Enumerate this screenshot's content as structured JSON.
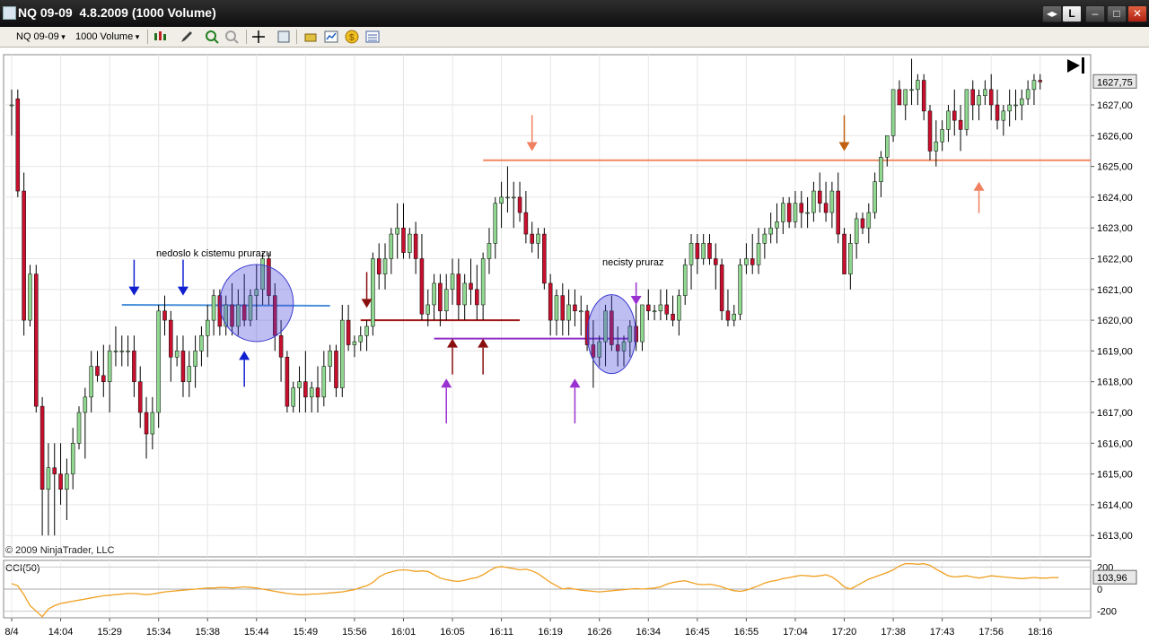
{
  "window": {
    "title": "NQ 09-09  4.8.2009 (1000 Volume)",
    "buttons": [
      "◂▸",
      "L",
      "–",
      "□",
      "✕"
    ]
  },
  "toolbar": {
    "instrument": "NQ 09-09",
    "period": "1000 Volume",
    "icons": [
      "candlestick-chart-icon",
      "pencil-draw-icon",
      "zoom-in-icon",
      "zoom-out-icon",
      "crosshair-icon",
      "data-box-icon",
      "strategy-icon",
      "indicator-icon",
      "money-icon",
      "properties-icon"
    ]
  },
  "colors": {
    "up": "#90d890",
    "down": "#c8102e",
    "wick": "#000000",
    "cci": "#f0a020",
    "blue_line": "#4a90d9",
    "orange_line": "#f08860",
    "darkred_line": "#a01818",
    "purple_line": "#9030c8"
  },
  "chart_data": {
    "type": "candlestick",
    "instrument": "NQ 09-09",
    "copyright": "© 2009 NinjaTrader, LLC",
    "price_axis": [
      "1627,00",
      "1626,00",
      "1625,00",
      "1624,00",
      "1623,00",
      "1622,00",
      "1621,00",
      "1620,00",
      "1619,00",
      "1618,00",
      "1617,00",
      "1616,00",
      "1615,00",
      "1614,00",
      "1613,00"
    ],
    "last_price": "1627,75",
    "ylim": [
      1612.5,
      1628.5
    ],
    "time_axis": [
      "8/4",
      "14:04",
      "15:29",
      "15:34",
      "15:38",
      "15:44",
      "15:49",
      "15:56",
      "16:01",
      "16:05",
      "16:11",
      "16:19",
      "16:26",
      "16:34",
      "16:45",
      "16:55",
      "17:04",
      "17:20",
      "17:38",
      "17:43",
      "17:56",
      "18:16"
    ],
    "time_tick_bars": [
      0,
      8,
      16,
      24,
      32,
      40,
      48,
      56,
      64,
      72,
      80,
      88,
      96,
      104,
      112,
      120,
      128,
      136,
      144,
      152,
      160,
      168
    ],
    "annotations": {
      "cistemu": "nedoslo k cistemu prurazu",
      "necisty": "necisty pruraz"
    },
    "levels": {
      "blue": 1620.5,
      "orange": 1625.2,
      "darkred": 1620.0,
      "purple": 1619.4
    },
    "candles": [
      [
        1627.0,
        1627.5,
        1626.0,
        1627.0
      ],
      [
        1627.2,
        1627.5,
        1624.0,
        1624.2
      ],
      [
        1624.2,
        1624.8,
        1619.5,
        1620.0
      ],
      [
        1620.0,
        1621.8,
        1619.8,
        1621.5
      ],
      [
        1621.5,
        1621.8,
        1617.0,
        1617.2
      ],
      [
        1617.2,
        1617.5,
        1613.0,
        1614.5
      ],
      [
        1614.5,
        1616.0,
        1613.0,
        1615.2
      ],
      [
        1615.2,
        1616.0,
        1613.0,
        1615.0
      ],
      [
        1615.0,
        1616.0,
        1614.0,
        1614.5
      ],
      [
        1614.5,
        1615.5,
        1613.5,
        1615.0
      ],
      [
        1615.0,
        1616.5,
        1614.5,
        1616.0
      ],
      [
        1616.0,
        1617.2,
        1615.8,
        1617.0
      ],
      [
        1617.0,
        1617.8,
        1615.5,
        1617.5
      ],
      [
        1617.5,
        1619.0,
        1617.0,
        1618.5
      ],
      [
        1618.5,
        1619.0,
        1618.0,
        1618.2
      ],
      [
        1618.2,
        1619.2,
        1617.5,
        1618.0
      ],
      [
        1618.0,
        1619.2,
        1617.0,
        1619.0
      ],
      [
        1619.0,
        1619.8,
        1618.5,
        1619.0
      ],
      [
        1619.0,
        1619.5,
        1618.5,
        1619.0
      ],
      [
        1619.0,
        1619.5,
        1618.5,
        1619.0
      ],
      [
        1619.0,
        1619.5,
        1617.5,
        1618.0
      ],
      [
        1618.0,
        1618.5,
        1616.5,
        1617.0
      ],
      [
        1617.0,
        1617.5,
        1615.5,
        1616.3
      ],
      [
        1616.3,
        1617.5,
        1615.8,
        1617.0
      ],
      [
        1617.0,
        1620.5,
        1616.5,
        1620.3
      ],
      [
        1620.3,
        1620.8,
        1619.5,
        1620.0
      ],
      [
        1620.0,
        1620.3,
        1618.0,
        1618.8
      ],
      [
        1618.8,
        1619.5,
        1618.5,
        1619.0
      ],
      [
        1619.0,
        1619.5,
        1617.5,
        1618.0
      ],
      [
        1618.0,
        1619.0,
        1617.5,
        1618.5
      ],
      [
        1618.5,
        1619.5,
        1617.8,
        1619.0
      ],
      [
        1619.0,
        1619.8,
        1618.5,
        1619.5
      ],
      [
        1619.5,
        1620.5,
        1618.8,
        1620.0
      ],
      [
        1620.0,
        1621.0,
        1619.5,
        1620.8
      ],
      [
        1620.8,
        1621.0,
        1619.5,
        1619.8
      ],
      [
        1619.8,
        1620.8,
        1619.5,
        1620.5
      ],
      [
        1620.5,
        1621.2,
        1619.5,
        1619.8
      ],
      [
        1619.8,
        1621.0,
        1619.5,
        1620.5
      ],
      [
        1620.5,
        1621.5,
        1619.8,
        1620.0
      ],
      [
        1620.0,
        1621.0,
        1619.8,
        1620.8
      ],
      [
        1620.8,
        1621.8,
        1620.0,
        1621.0
      ],
      [
        1621.0,
        1622.2,
        1620.5,
        1622.0
      ],
      [
        1622.0,
        1622.2,
        1620.5,
        1620.8
      ],
      [
        1620.8,
        1621.2,
        1619.0,
        1619.5
      ],
      [
        1619.5,
        1620.0,
        1618.0,
        1618.8
      ],
      [
        1618.8,
        1619.0,
        1617.0,
        1617.2
      ],
      [
        1617.2,
        1618.0,
        1617.0,
        1617.8
      ],
      [
        1617.8,
        1618.5,
        1617.0,
        1618.0
      ],
      [
        1618.0,
        1619.0,
        1617.0,
        1617.5
      ],
      [
        1617.5,
        1618.0,
        1617.0,
        1617.8
      ],
      [
        1617.8,
        1618.5,
        1617.0,
        1617.5
      ],
      [
        1617.5,
        1619.0,
        1617.2,
        1618.5
      ],
      [
        1618.5,
        1619.2,
        1618.0,
        1619.0
      ],
      [
        1619.0,
        1619.2,
        1617.5,
        1617.8
      ],
      [
        1617.8,
        1620.5,
        1617.5,
        1620.0
      ],
      [
        1620.0,
        1620.5,
        1619.0,
        1619.2
      ],
      [
        1619.2,
        1619.5,
        1618.8,
        1619.3
      ],
      [
        1619.3,
        1619.8,
        1619.0,
        1619.5
      ],
      [
        1619.5,
        1620.0,
        1619.0,
        1619.8
      ],
      [
        1619.8,
        1622.2,
        1619.5,
        1622.0
      ],
      [
        1622.0,
        1622.5,
        1621.0,
        1621.5
      ],
      [
        1621.5,
        1622.5,
        1621.0,
        1622.0
      ],
      [
        1622.0,
        1623.0,
        1621.5,
        1622.8
      ],
      [
        1622.8,
        1623.8,
        1622.0,
        1623.0
      ],
      [
        1623.0,
        1623.8,
        1622.0,
        1622.2
      ],
      [
        1622.2,
        1623.0,
        1622.0,
        1622.8
      ],
      [
        1622.8,
        1623.2,
        1621.5,
        1622.0
      ],
      [
        1622.0,
        1622.8,
        1620.0,
        1620.2
      ],
      [
        1620.2,
        1621.0,
        1619.8,
        1620.5
      ],
      [
        1620.5,
        1621.5,
        1620.0,
        1621.2
      ],
      [
        1621.2,
        1621.5,
        1619.8,
        1620.3
      ],
      [
        1620.3,
        1621.5,
        1620.0,
        1621.0
      ],
      [
        1621.0,
        1622.0,
        1620.5,
        1621.5
      ],
      [
        1621.5,
        1622.0,
        1620.0,
        1620.5
      ],
      [
        1620.5,
        1621.5,
        1620.0,
        1621.2
      ],
      [
        1621.2,
        1622.0,
        1620.5,
        1621.0
      ],
      [
        1621.0,
        1621.8,
        1620.0,
        1620.5
      ],
      [
        1620.5,
        1622.2,
        1620.0,
        1622.0
      ],
      [
        1622.0,
        1623.0,
        1621.5,
        1622.5
      ],
      [
        1622.5,
        1624.0,
        1622.0,
        1623.8
      ],
      [
        1623.8,
        1624.5,
        1623.0,
        1624.0
      ],
      [
        1624.0,
        1625.0,
        1623.5,
        1624.0
      ],
      [
        1624.0,
        1624.5,
        1623.0,
        1624.0
      ],
      [
        1624.0,
        1624.5,
        1623.2,
        1623.5
      ],
      [
        1623.5,
        1624.2,
        1622.5,
        1622.8
      ],
      [
        1622.8,
        1623.2,
        1622.2,
        1622.5
      ],
      [
        1622.5,
        1623.0,
        1622.0,
        1622.8
      ],
      [
        1622.8,
        1623.0,
        1621.0,
        1621.2
      ],
      [
        1621.2,
        1621.5,
        1619.5,
        1620.0
      ],
      [
        1620.0,
        1621.0,
        1619.5,
        1620.8
      ],
      [
        1620.8,
        1621.2,
        1619.5,
        1620.0
      ],
      [
        1620.0,
        1621.0,
        1619.5,
        1620.5
      ],
      [
        1620.5,
        1621.0,
        1619.8,
        1620.3
      ],
      [
        1620.3,
        1620.8,
        1619.5,
        1620.3
      ],
      [
        1620.3,
        1620.5,
        1619.0,
        1619.2
      ],
      [
        1619.2,
        1620.0,
        1617.8,
        1618.8
      ],
      [
        1618.8,
        1619.5,
        1618.5,
        1619.3
      ],
      [
        1619.3,
        1620.5,
        1618.5,
        1620.3
      ],
      [
        1620.3,
        1620.8,
        1619.0,
        1619.2
      ],
      [
        1619.2,
        1619.8,
        1618.5,
        1619.0
      ],
      [
        1619.0,
        1619.5,
        1618.5,
        1619.3
      ],
      [
        1619.3,
        1620.0,
        1618.8,
        1619.8
      ],
      [
        1619.8,
        1620.8,
        1619.0,
        1619.3
      ],
      [
        1619.3,
        1620.5,
        1619.0,
        1620.5
      ],
      [
        1620.5,
        1621.0,
        1620.0,
        1620.3
      ],
      [
        1620.3,
        1620.5,
        1620.0,
        1620.3
      ],
      [
        1620.3,
        1621.0,
        1620.0,
        1620.5
      ],
      [
        1620.5,
        1621.0,
        1620.0,
        1620.2
      ],
      [
        1620.2,
        1620.8,
        1619.8,
        1620.0
      ],
      [
        1620.0,
        1621.0,
        1619.5,
        1620.8
      ],
      [
        1620.8,
        1622.0,
        1620.5,
        1621.8
      ],
      [
        1621.8,
        1622.8,
        1621.0,
        1622.5
      ],
      [
        1622.5,
        1622.8,
        1621.5,
        1622.0
      ],
      [
        1622.0,
        1622.8,
        1621.8,
        1622.5
      ],
      [
        1622.5,
        1622.8,
        1621.8,
        1622.0
      ],
      [
        1622.0,
        1622.5,
        1621.0,
        1621.8
      ],
      [
        1621.8,
        1622.0,
        1620.0,
        1620.3
      ],
      [
        1620.3,
        1621.0,
        1619.8,
        1620.0
      ],
      [
        1620.0,
        1620.5,
        1619.8,
        1620.2
      ],
      [
        1620.2,
        1622.0,
        1620.0,
        1621.8
      ],
      [
        1621.8,
        1622.5,
        1621.5,
        1622.0
      ],
      [
        1622.0,
        1622.8,
        1621.5,
        1621.8
      ],
      [
        1621.8,
        1623.0,
        1621.5,
        1622.5
      ],
      [
        1622.5,
        1623.0,
        1622.0,
        1622.8
      ],
      [
        1622.8,
        1623.5,
        1622.5,
        1623.0
      ],
      [
        1623.0,
        1623.8,
        1622.5,
        1623.2
      ],
      [
        1623.2,
        1624.0,
        1622.8,
        1623.8
      ],
      [
        1623.8,
        1624.0,
        1623.0,
        1623.2
      ],
      [
        1623.2,
        1624.2,
        1623.0,
        1623.8
      ],
      [
        1623.8,
        1624.2,
        1623.0,
        1623.5
      ],
      [
        1623.5,
        1624.0,
        1623.0,
        1623.5
      ],
      [
        1623.5,
        1624.5,
        1623.2,
        1624.2
      ],
      [
        1624.2,
        1624.8,
        1623.5,
        1623.8
      ],
      [
        1623.8,
        1624.5,
        1623.2,
        1623.5
      ],
      [
        1623.5,
        1624.5,
        1623.0,
        1624.2
      ],
      [
        1624.2,
        1624.8,
        1622.5,
        1622.8
      ],
      [
        1622.8,
        1623.0,
        1621.5,
        1621.5
      ],
      [
        1621.5,
        1622.8,
        1621.0,
        1622.5
      ],
      [
        1622.5,
        1623.5,
        1622.0,
        1623.3
      ],
      [
        1623.3,
        1623.5,
        1622.8,
        1623.0
      ],
      [
        1623.0,
        1623.8,
        1622.5,
        1623.5
      ],
      [
        1623.5,
        1624.8,
        1623.3,
        1624.5
      ],
      [
        1624.5,
        1625.5,
        1624.0,
        1625.3
      ],
      [
        1625.3,
        1626.0,
        1625.0,
        1626.0
      ],
      [
        1626.0,
        1627.5,
        1625.8,
        1627.5
      ],
      [
        1627.5,
        1627.8,
        1627.0,
        1627.0
      ],
      [
        1627.0,
        1627.5,
        1626.5,
        1627.5
      ],
      [
        1627.5,
        1628.5,
        1627.0,
        1627.5
      ],
      [
        1627.5,
        1628.0,
        1627.0,
        1627.8
      ],
      [
        1627.8,
        1628.0,
        1626.5,
        1626.8
      ],
      [
        1626.8,
        1627.0,
        1625.2,
        1625.5
      ],
      [
        1625.5,
        1626.5,
        1625.0,
        1625.8
      ],
      [
        1625.8,
        1626.5,
        1625.5,
        1626.2
      ],
      [
        1626.2,
        1627.0,
        1625.8,
        1626.8
      ],
      [
        1626.8,
        1627.5,
        1626.0,
        1626.5
      ],
      [
        1626.5,
        1627.0,
        1625.5,
        1626.2
      ],
      [
        1626.2,
        1627.5,
        1626.0,
        1627.5
      ],
      [
        1627.5,
        1627.8,
        1626.5,
        1627.0
      ],
      [
        1627.0,
        1627.5,
        1626.5,
        1627.3
      ],
      [
        1627.3,
        1627.8,
        1627.0,
        1627.5
      ],
      [
        1627.5,
        1628.0,
        1626.5,
        1627.0
      ],
      [
        1627.0,
        1627.5,
        1626.2,
        1626.5
      ],
      [
        1626.5,
        1627.0,
        1626.0,
        1626.8
      ],
      [
        1626.8,
        1627.5,
        1626.3,
        1627.0
      ],
      [
        1627.0,
        1627.5,
        1626.5,
        1627.0
      ],
      [
        1627.0,
        1627.5,
        1626.5,
        1627.2
      ],
      [
        1627.2,
        1627.8,
        1627.0,
        1627.5
      ],
      [
        1627.5,
        1628.0,
        1627.0,
        1627.8
      ],
      [
        1627.8,
        1628.0,
        1627.5,
        1627.75
      ]
    ],
    "cci": {
      "label": "CCI(50)",
      "value_label": "103,96",
      "axis": [
        "200",
        "0",
        "-200"
      ],
      "ylim": [
        -260,
        260
      ],
      "values": [
        50,
        30,
        -50,
        -150,
        -200,
        -250,
        -180,
        -150,
        -130,
        -120,
        -110,
        -100,
        -90,
        -80,
        -70,
        -60,
        -55,
        -50,
        -45,
        -40,
        -40,
        -45,
        -50,
        -45,
        -35,
        -25,
        -20,
        -15,
        -10,
        -5,
        0,
        5,
        10,
        10,
        15,
        15,
        10,
        15,
        20,
        15,
        10,
        0,
        -10,
        -20,
        -30,
        -40,
        -45,
        -50,
        -50,
        -45,
        -45,
        -40,
        -35,
        -30,
        -25,
        -15,
        -5,
        15,
        30,
        60,
        110,
        140,
        155,
        170,
        175,
        170,
        160,
        165,
        160,
        130,
        100,
        85,
        75,
        70,
        80,
        95,
        105,
        130,
        165,
        195,
        205,
        195,
        185,
        175,
        180,
        165,
        140,
        100,
        60,
        30,
        0,
        10,
        0,
        -10,
        -15,
        -20,
        -25,
        -20,
        -15,
        -10,
        -5,
        0,
        5,
        0,
        5,
        10,
        20,
        45,
        60,
        70,
        75,
        60,
        45,
        40,
        45,
        35,
        20,
        0,
        -15,
        -20,
        -10,
        10,
        30,
        55,
        70,
        80,
        95,
        105,
        115,
        125,
        120,
        115,
        120,
        130,
        110,
        70,
        20,
        0,
        30,
        60,
        90,
        110,
        130,
        150,
        175,
        210,
        230,
        230,
        225,
        230,
        215,
        180,
        150,
        120,
        110,
        115,
        120,
        110,
        100,
        110,
        120,
        115,
        110,
        105,
        100,
        95,
        100,
        105,
        100,
        100,
        105,
        104
      ]
    }
  }
}
